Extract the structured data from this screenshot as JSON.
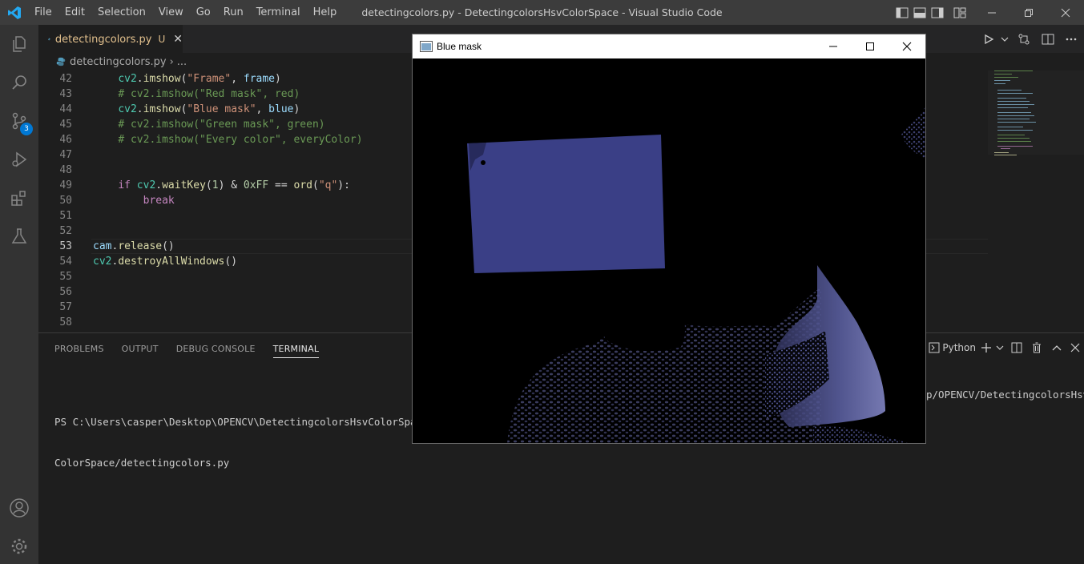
{
  "titlebar": {
    "menu": [
      "File",
      "Edit",
      "Selection",
      "View",
      "Go",
      "Run",
      "Terminal",
      "Help"
    ],
    "window_title": "detectingcolors.py - DetectingcolorsHsvColorSpace - Visual Studio Code"
  },
  "activity_bar": {
    "source_control_badge": "3"
  },
  "tab": {
    "label": "detectingcolors.py",
    "status": "U",
    "close": "✕"
  },
  "breadcrumb": {
    "file": "detectingcolors.py",
    "separator": "›",
    "rest": "..."
  },
  "editor": {
    "lines": [
      {
        "n": "42",
        "parts": [
          [
            "    ",
            ""
          ],
          [
            "cv2",
            "k-var"
          ],
          [
            ".",
            ""
          ],
          [
            "imshow",
            "k-fn"
          ],
          [
            "(",
            ""
          ],
          [
            "\"Frame\"",
            "k-str"
          ],
          [
            ", ",
            ""
          ],
          [
            "frame",
            "k-id"
          ],
          [
            ")",
            ""
          ]
        ]
      },
      {
        "n": "43",
        "parts": [
          [
            "    ",
            ""
          ],
          [
            "# cv2.imshow(\"Red mask\", red)",
            "k-com"
          ]
        ]
      },
      {
        "n": "44",
        "parts": [
          [
            "    ",
            ""
          ],
          [
            "cv2",
            "k-var"
          ],
          [
            ".",
            ""
          ],
          [
            "imshow",
            "k-fn"
          ],
          [
            "(",
            ""
          ],
          [
            "\"Blue mask\"",
            "k-str"
          ],
          [
            ", ",
            ""
          ],
          [
            "blue",
            "k-id"
          ],
          [
            ")",
            ""
          ]
        ]
      },
      {
        "n": "45",
        "parts": [
          [
            "    ",
            ""
          ],
          [
            "# cv2.imshow(\"Green mask\", green)",
            "k-com"
          ]
        ]
      },
      {
        "n": "46",
        "parts": [
          [
            "    ",
            ""
          ],
          [
            "# cv2.imshow(\"Every color\", everyColor)",
            "k-com"
          ]
        ]
      },
      {
        "n": "47",
        "parts": []
      },
      {
        "n": "48",
        "parts": []
      },
      {
        "n": "49",
        "parts": [
          [
            "    ",
            ""
          ],
          [
            "if",
            "k-kw"
          ],
          [
            " ",
            ""
          ],
          [
            "cv2",
            "k-var"
          ],
          [
            ".",
            ""
          ],
          [
            "waitKey",
            "k-fn"
          ],
          [
            "(",
            ""
          ],
          [
            "1",
            "k-num"
          ],
          [
            ") & ",
            ""
          ],
          [
            "0xFF",
            "k-num"
          ],
          [
            " == ",
            ""
          ],
          [
            "ord",
            "k-fn"
          ],
          [
            "(",
            ""
          ],
          [
            "\"q\"",
            "k-str"
          ],
          [
            "):",
            ""
          ]
        ]
      },
      {
        "n": "50",
        "parts": [
          [
            "        ",
            ""
          ],
          [
            "break",
            "k-kw"
          ]
        ]
      },
      {
        "n": "51",
        "parts": []
      },
      {
        "n": "52",
        "parts": []
      },
      {
        "n": "53",
        "parts": [
          [
            "cam",
            "k-id"
          ],
          [
            ".",
            ""
          ],
          [
            "release",
            "k-fn"
          ],
          [
            "()",
            ""
          ]
        ],
        "active": true
      },
      {
        "n": "54",
        "parts": [
          [
            "cv2",
            "k-var"
          ],
          [
            ".",
            ""
          ],
          [
            "destroyAllWindows",
            "k-fn"
          ],
          [
            "()",
            ""
          ]
        ]
      },
      {
        "n": "55",
        "parts": []
      },
      {
        "n": "56",
        "parts": []
      },
      {
        "n": "57",
        "parts": []
      },
      {
        "n": "58",
        "parts": []
      }
    ]
  },
  "panel": {
    "tabs": [
      "PROBLEMS",
      "OUTPUT",
      "DEBUG CONSOLE",
      "TERMINAL"
    ],
    "active_tab": "TERMINAL",
    "terminal_profile": "Python",
    "terminal_lines": [
      "PS C:\\Users\\casper\\Desktop\\OPENCV\\DetectingcolorsHsvColorSpace>",
      "ColorSpace/detectingcolors.py"
    ],
    "terminal_line_right": "p/OPENCV/DetectingcolorsHsv"
  },
  "cv_window": {
    "title": "Blue mask"
  },
  "colors": {
    "titlebar_bg": "#3c3c3c",
    "activitybar_bg": "#333333",
    "editor_bg": "#1e1e1e",
    "accent": "#0078d4",
    "mask_blue": "#3a3f86"
  }
}
